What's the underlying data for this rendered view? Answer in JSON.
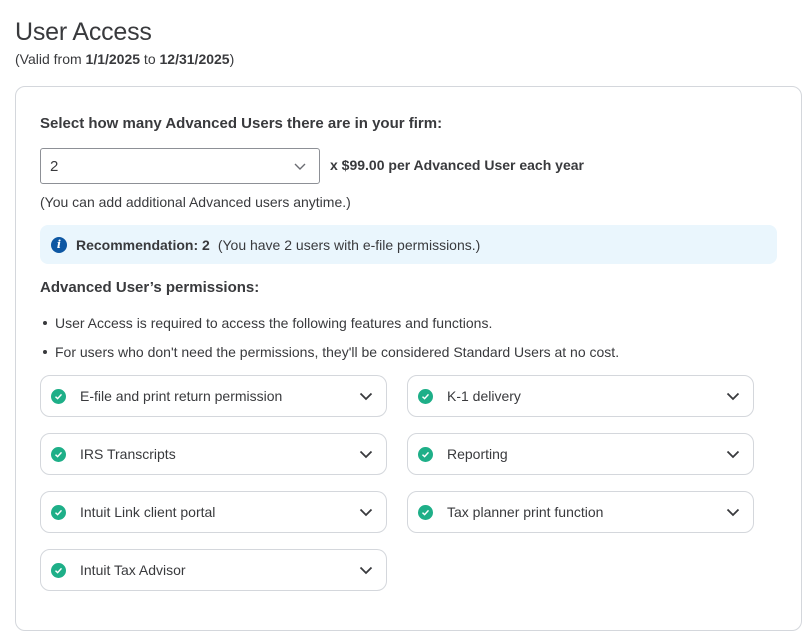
{
  "header": {
    "title": "User Access",
    "validity_prefix": "(Valid from ",
    "valid_from": "1/1/2025",
    "validity_mid": " to ",
    "valid_to": "12/31/2025",
    "validity_suffix": ")"
  },
  "user_count": {
    "label": "Select how many Advanced Users there are in your firm:",
    "selected_value": "2",
    "price_text": "x $99.00 per Advanced User each year",
    "note": "(You can add additional Advanced users anytime.)"
  },
  "recommendation": {
    "icon": "info-icon",
    "label": "Recommendation: 2",
    "detail": "(You have 2 users with e-file permissions.)"
  },
  "permissions": {
    "heading": "Advanced User’s permissions:",
    "bullets": [
      "User Access is required to access the following features and functions.",
      "For users who don't need the permissions, they'll be considered Standard Users at no cost."
    ],
    "items": [
      {
        "label": "E-file and print return permission",
        "icon": "check-circle-icon"
      },
      {
        "label": "K-1 delivery",
        "icon": "check-circle-icon"
      },
      {
        "label": "IRS Transcripts",
        "icon": "check-circle-icon"
      },
      {
        "label": "Reporting",
        "icon": "check-circle-icon"
      },
      {
        "label": "Intuit Link client portal",
        "icon": "check-circle-icon"
      },
      {
        "label": "Tax planner print function",
        "icon": "check-circle-icon"
      },
      {
        "label": "Intuit Tax Advisor",
        "icon": "check-circle-icon"
      }
    ]
  },
  "colors": {
    "text": "#393a3d",
    "check_green": "#1eaf88",
    "info_blue": "#0d57a3",
    "banner_bg": "#eaf6fd",
    "border": "#d4d7dc"
  }
}
